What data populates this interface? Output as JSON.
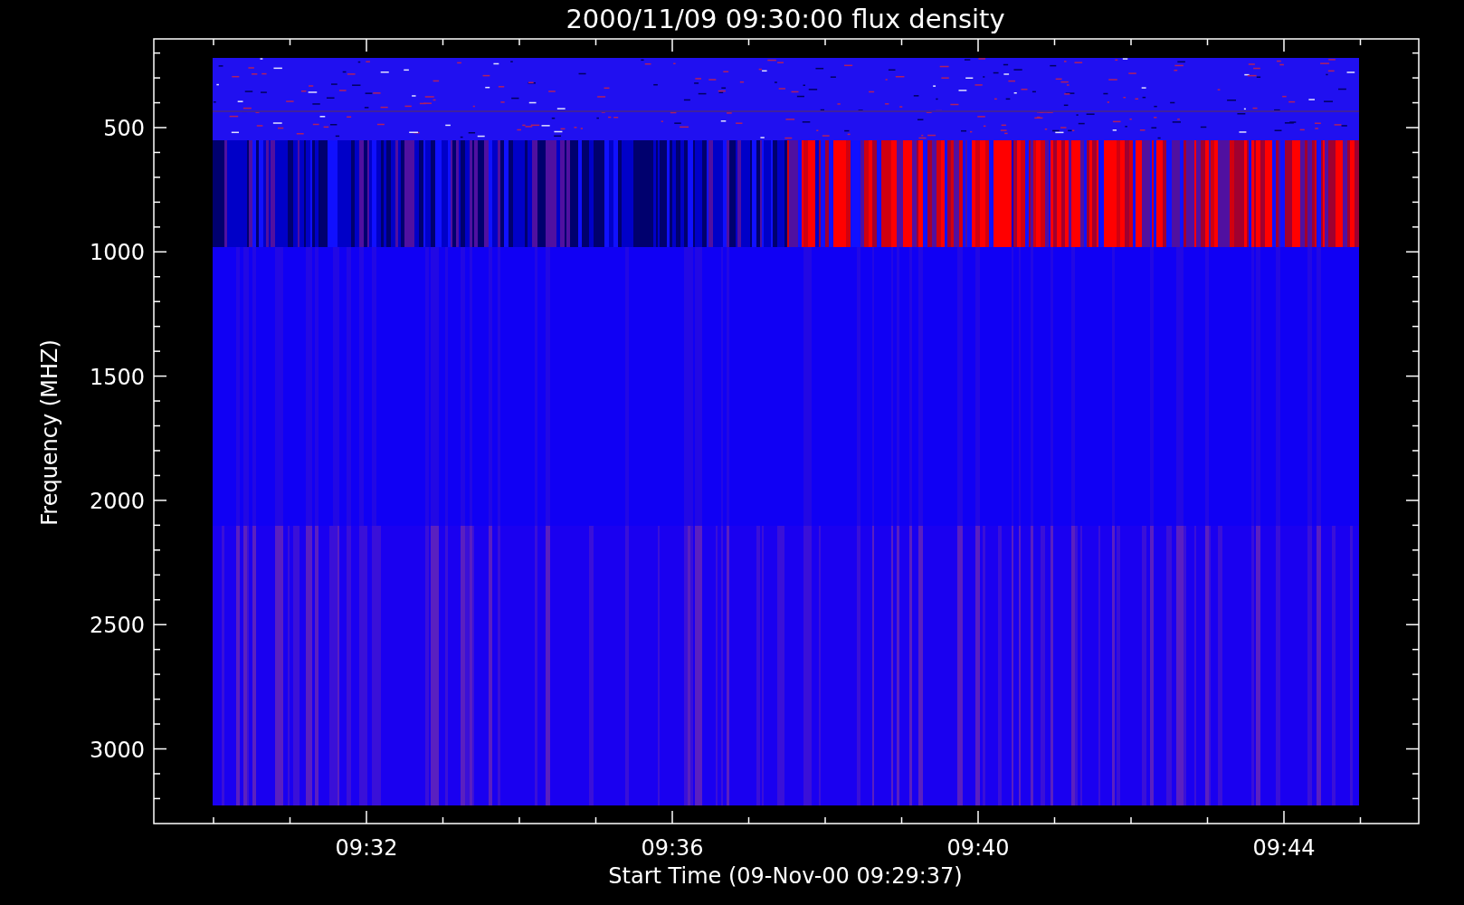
{
  "title": "2000/11/09 09:30:00 flux density",
  "y_axis": {
    "label": "Frequency (MHZ)",
    "ticks": [
      "500",
      "1000",
      "1500",
      "2000",
      "2500",
      "3000"
    ]
  },
  "x_axis": {
    "label": "Start Time (09-Nov-00 09:29:37)",
    "ticks": [
      "09:32",
      "09:36",
      "09:40",
      "09:44"
    ]
  }
}
